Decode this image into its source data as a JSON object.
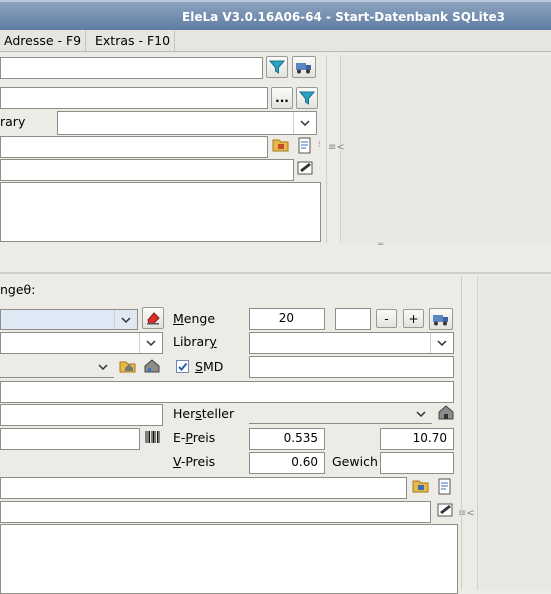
{
  "window": {
    "title": "EleLa V3.0.16A06-64  - Start-Datenbank SQLite3"
  },
  "menu": {
    "items": [
      "Adresse - F9",
      "Extras - F10"
    ]
  },
  "top": {
    "library_label": "rary",
    "splitter_marker": "≡<",
    "dots_label": "..."
  },
  "bottom": {
    "header_label": "ngeθ:",
    "menge_label": "Menge",
    "menge_value": "20",
    "stepper_value": "",
    "minus_label": "-",
    "plus_label": "+",
    "library_label": "Library",
    "smd_label": "SMD",
    "smd_checked": true,
    "hersteller_label": "Hersteller",
    "epreis_label": "E-Preis",
    "epreis_value": "0.535",
    "epreis_total": "10.70",
    "vpreis_label": "V-Preis",
    "vpreis_value": "0.60",
    "gewicht_label": "Gewich",
    "gewicht_value": "",
    "splitter_marker": "≡<"
  },
  "colors": {
    "title_bg": "#6f8ab0",
    "panel_bg": "#ecebe6",
    "selected_combo": "#dfe9f6"
  }
}
